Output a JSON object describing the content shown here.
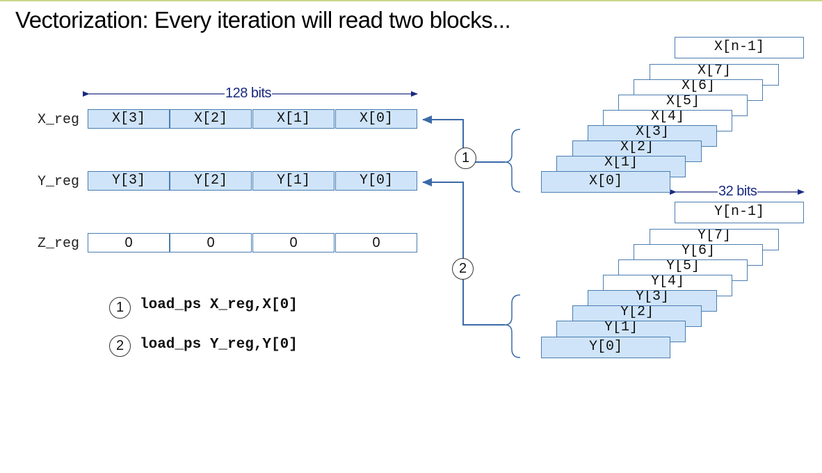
{
  "title": "Vectorization: Every iteration will read two blocks...",
  "registers": [
    {
      "label": "X_reg",
      "cells": [
        "X[3]",
        "X[2]",
        "X[1]",
        "X[0]"
      ]
    },
    {
      "label": "Y_reg",
      "cells": [
        "Y[3]",
        "Y[2]",
        "Y[1]",
        "Y[0]"
      ]
    },
    {
      "label": "Z_reg",
      "cells": [
        "0",
        "0",
        "0",
        "0"
      ]
    }
  ],
  "dimensions": {
    "register_width": "128 bits",
    "element_width": "32 bits"
  },
  "x_memory": {
    "last": "X[n-1]",
    "blocks": [
      "X[7]",
      "X[6]",
      "X[5]",
      "X[4]",
      "X[3]",
      "X[2]",
      "X[1]",
      "X[0]"
    ]
  },
  "y_memory": {
    "last": "Y[n-1]",
    "blocks": [
      "Y[7]",
      "Y[6]",
      "Y[5]",
      "Y[4]",
      "Y[3]",
      "Y[2]",
      "Y[1]",
      "Y[0]"
    ]
  },
  "steps": [
    {
      "number": "1",
      "instruction": "load_ps X_reg,X[0]"
    },
    {
      "number": "2",
      "instruction": "load_ps Y_reg,Y[0]"
    }
  ],
  "colors": {
    "highlight_fill": "#cfe4f8",
    "border": "#4a7db0",
    "arrow": "#3b6aa8",
    "dimension_text": "#1a2a80"
  }
}
